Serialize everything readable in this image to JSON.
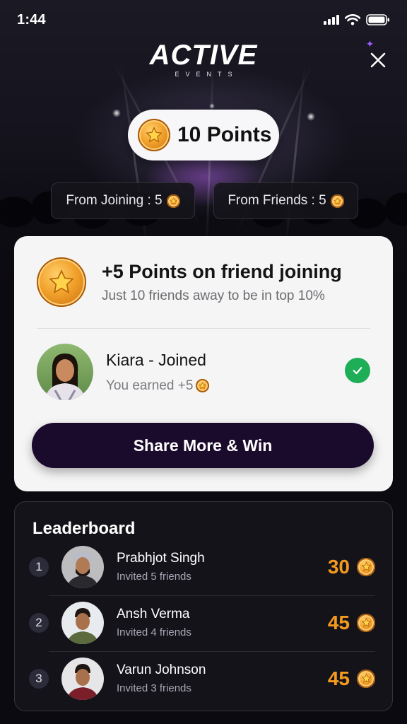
{
  "status_bar": {
    "time": "1:44"
  },
  "header": {
    "logo_text": "ACTIVE",
    "logo_subtext": "EVENTS"
  },
  "points": {
    "total_label": "10 Points"
  },
  "stats": {
    "joining_label": "From Joining : 5",
    "friends_label": "From Friends : 5"
  },
  "reward_card": {
    "title": "+5 Points on friend joining",
    "subtitle": "Just 10 friends away to be in top 10%",
    "friend": {
      "name": "Kiara - Joined",
      "earned_label": "You earned +5"
    },
    "share_button": "Share More & Win"
  },
  "leaderboard": {
    "title": "Leaderboard",
    "rows": [
      {
        "rank": "1",
        "name": "Prabhjot Singh",
        "subtitle": "Invited 5 friends",
        "score": "30"
      },
      {
        "rank": "2",
        "name": "Ansh Verma",
        "subtitle": "Invited 4 friends",
        "score": "45"
      },
      {
        "rank": "3",
        "name": "Varun Johnson",
        "subtitle": "Invited 3 friends",
        "score": "45"
      }
    ]
  },
  "colors": {
    "accent_dark": "#1a0a2b",
    "score_orange": "#f39a1f",
    "success_green": "#1eae57",
    "coin_gold": "#f0a02a"
  },
  "icons": [
    "signal-icon",
    "wifi-icon",
    "battery-icon",
    "close-icon",
    "coin-icon",
    "check-icon",
    "avatar"
  ]
}
